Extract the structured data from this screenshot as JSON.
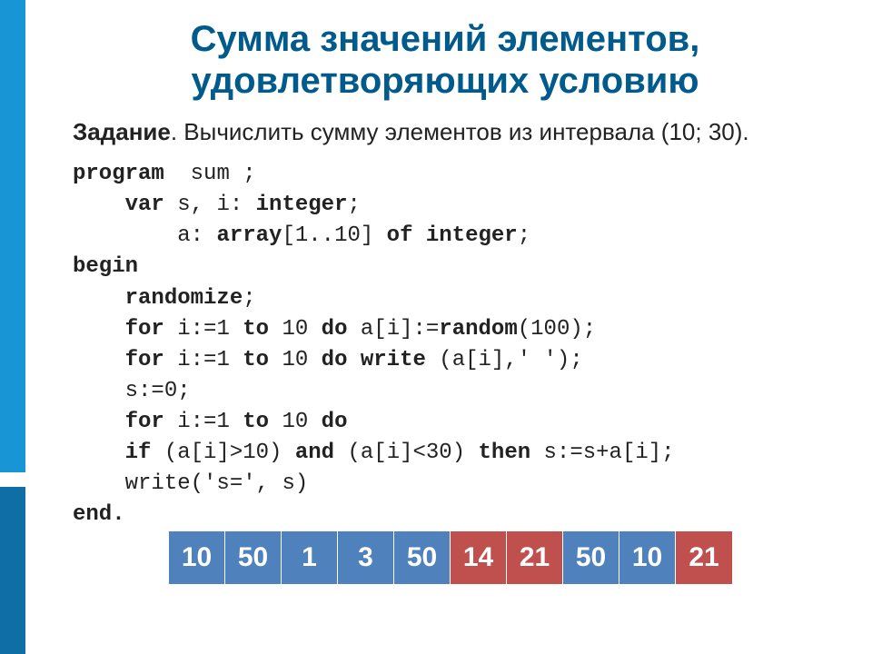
{
  "title_line1": "Сумма значений элементов,",
  "title_line2": "удовлетворяющих условию",
  "task_label": "Задание",
  "task_text": ". Вычислить сумму элементов из интервала (10; 30).",
  "code": {
    "l1a": "program",
    "l1b": "  sum ;",
    "l2a": "    var",
    "l2b": " s, i: ",
    "l2c": "integer",
    "l2d": ";",
    "l3a": "        a: ",
    "l3b": "array",
    "l3c": "[1..10] ",
    "l3d": "of integer",
    "l3e": ";",
    "l4": "begin",
    "l5a": "    ",
    "l5b": "randomize",
    "l5c": ";",
    "l6a": "    for",
    "l6b": " i:=1 ",
    "l6c": "to",
    "l6d": " 10 ",
    "l6e": "do",
    "l6f": " a[i]:=",
    "l6g": "random",
    "l6h": "(100);",
    "l7a": "    for",
    "l7b": " i:=1 ",
    "l7c": "to",
    "l7d": " 10 ",
    "l7e": "do write",
    "l7f": " (a[i],' ');",
    "l8": "    s:=0;",
    "l9a": "    for",
    "l9b": " i:=1 ",
    "l9c": "to",
    "l9d": " 10 ",
    "l9e": "do",
    "l10a": "    if",
    "l10b": " (a[i]>10) ",
    "l10c": "and",
    "l10d": " (a[i]<30) ",
    "l10e": "then",
    "l10f": " s:=s+a[i];",
    "l11": "    write('s=', s)",
    "l12": "end."
  },
  "array": [
    {
      "v": "10",
      "hl": false
    },
    {
      "v": "50",
      "hl": false
    },
    {
      "v": "1",
      "hl": false
    },
    {
      "v": "3",
      "hl": false
    },
    {
      "v": "50",
      "hl": false
    },
    {
      "v": "14",
      "hl": true
    },
    {
      "v": "21",
      "hl": true
    },
    {
      "v": "50",
      "hl": false
    },
    {
      "v": "10",
      "hl": false
    },
    {
      "v": "21",
      "hl": true
    }
  ]
}
